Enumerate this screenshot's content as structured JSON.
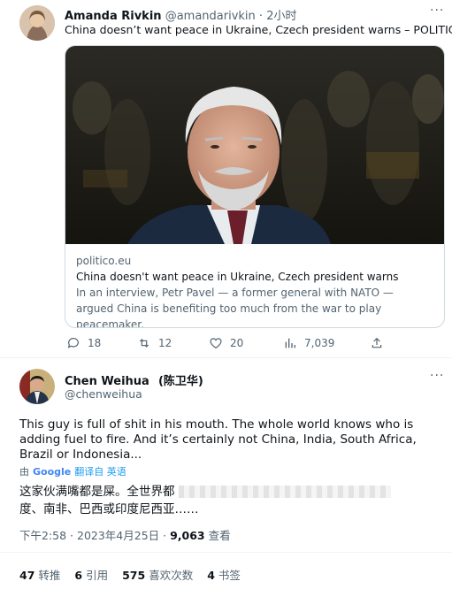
{
  "tweet1": {
    "author_name": "Amanda Rivkin",
    "author_handle": "@amandarivkin",
    "separator": "·",
    "time": "2小时",
    "text": "China doesn’t want peace in Ukraine, Czech president warns – POLITICO",
    "card": {
      "domain": "politico.eu",
      "title": "China doesn't want peace in Ukraine, Czech president warns",
      "description": "In an interview, Petr Pavel — a former general with NATO — argued China is benefiting too much from the war to play peacemaker."
    },
    "actions": {
      "replies": "18",
      "retweets": "12",
      "likes": "20",
      "views": "7,039"
    }
  },
  "tweet2": {
    "author_name": "Chen Weihua",
    "author_name_cn": "(陈卫华)",
    "author_handle": "@chenweihua",
    "text": "This guy is full of shit in his mouth. The whole world knows who is adding fuel to fire. And it’s certainly not China, India, South Africa, Brazil or Indonesia...",
    "translate_by": "由",
    "translate_provider": "Google",
    "translate_label": "翻译自 英语",
    "translation_line1": "这家伙满嘴都是屎。全世界都",
    "translation_line2": "度、南非、巴西或印度尼西亚……",
    "timestamp": "下午2:58 · 2023年4月25日 ·",
    "views_count": "9,063",
    "views_label": "查看",
    "stats": [
      {
        "num": "47",
        "label": "转推"
      },
      {
        "num": "6",
        "label": "引用"
      },
      {
        "num": "575",
        "label": "喜欢次数"
      },
      {
        "num": "4",
        "label": "书签"
      }
    ]
  },
  "colors": {
    "text": "#0f1419",
    "muted": "#536471",
    "link_blue": "#1d9bf0",
    "border": "#cfd9de"
  }
}
